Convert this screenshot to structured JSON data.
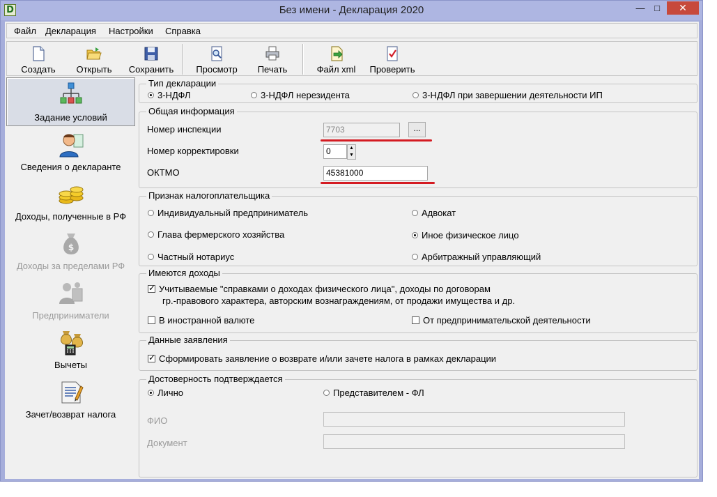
{
  "window": {
    "title": "Без имени - Декларация 2020",
    "app_icon_letter": "D",
    "minimize_glyph": "—",
    "maximize_glyph": "□",
    "close_glyph": "✕"
  },
  "menu": [
    "Файл",
    "Декларация",
    "Настройки",
    "Справка"
  ],
  "toolbar": [
    {
      "label": "Создать",
      "icon": "new-document-icon"
    },
    {
      "label": "Открыть",
      "icon": "open-folder-icon"
    },
    {
      "label": "Сохранить",
      "icon": "floppy-disk-icon"
    },
    {
      "label": "Просмотр",
      "icon": "preview-icon"
    },
    {
      "label": "Печать",
      "icon": "printer-icon"
    },
    {
      "label": "Файл xml",
      "icon": "xml-export-icon"
    },
    {
      "label": "Проверить",
      "icon": "check-document-icon"
    }
  ],
  "sidebar": [
    {
      "label": "Задание условий",
      "icon": "conditions-tree-icon",
      "active": true,
      "disabled": false
    },
    {
      "label": "Сведения о декларанте",
      "icon": "person-icon",
      "active": false,
      "disabled": false
    },
    {
      "label": "Доходы, полученные в РФ",
      "icon": "coins-icon",
      "active": false,
      "disabled": false
    },
    {
      "label": "Доходы за пределами РФ",
      "icon": "money-bag-icon",
      "active": false,
      "disabled": true
    },
    {
      "label": "Предприниматели",
      "icon": "entrepreneur-icon",
      "active": false,
      "disabled": true
    },
    {
      "label": "Вычеты",
      "icon": "deductions-icon",
      "active": false,
      "disabled": false
    },
    {
      "label": "Зачет/возврат налога",
      "icon": "tax-refund-icon",
      "active": false,
      "disabled": false
    }
  ],
  "declaration_type": {
    "title": "Тип декларации",
    "options": [
      "3-НДФЛ",
      "3-НДФЛ нерезидента",
      "3-НДФЛ при завершении деятельности ИП"
    ],
    "selected": 0
  },
  "general_info": {
    "title": "Общая информация",
    "inspection_label": "Номер инспекции",
    "inspection_value": "7703",
    "browse_label": "...",
    "correction_label": "Номер корректировки",
    "correction_value": "0",
    "oktmo_label": "ОКТМО",
    "oktmo_value": "45381000"
  },
  "taxpayer_sign": {
    "title": "Признак налогоплательщика",
    "options": [
      "Индивидуальный предприниматель",
      "Адвокат",
      "Глава фермерского хозяйства",
      "Иное физическое лицо",
      "Частный нотариус",
      "Арбитражный управляющий"
    ],
    "selected": 3
  },
  "income": {
    "title": "Имеются доходы",
    "items": [
      {
        "label_line1": "Учитываемые \"справками о доходах физического лица\", доходы по договорам",
        "label_line2": "гр.-правового характера, авторским вознаграждениям, от продажи имущества и др.",
        "checked": true
      },
      {
        "label": "В иностранной валюте",
        "checked": false
      },
      {
        "label": "От предпринимательской деятельности",
        "checked": false
      }
    ]
  },
  "application": {
    "title": "Данные заявления",
    "label": "Сформировать заявление о  возврате и/или зачете налога в рамках декларации",
    "checked": true
  },
  "confirmation": {
    "title": "Достоверность подтверждается",
    "options": [
      "Лично",
      "Представителем - ФЛ"
    ],
    "selected": 0,
    "fio_label": "ФИО",
    "fio_value": "",
    "document_label": "Документ",
    "document_value": ""
  },
  "colors": {
    "annotation_underline": "#d41b22",
    "titlebar": "#aeb6e2",
    "close_button": "#c7493c"
  }
}
